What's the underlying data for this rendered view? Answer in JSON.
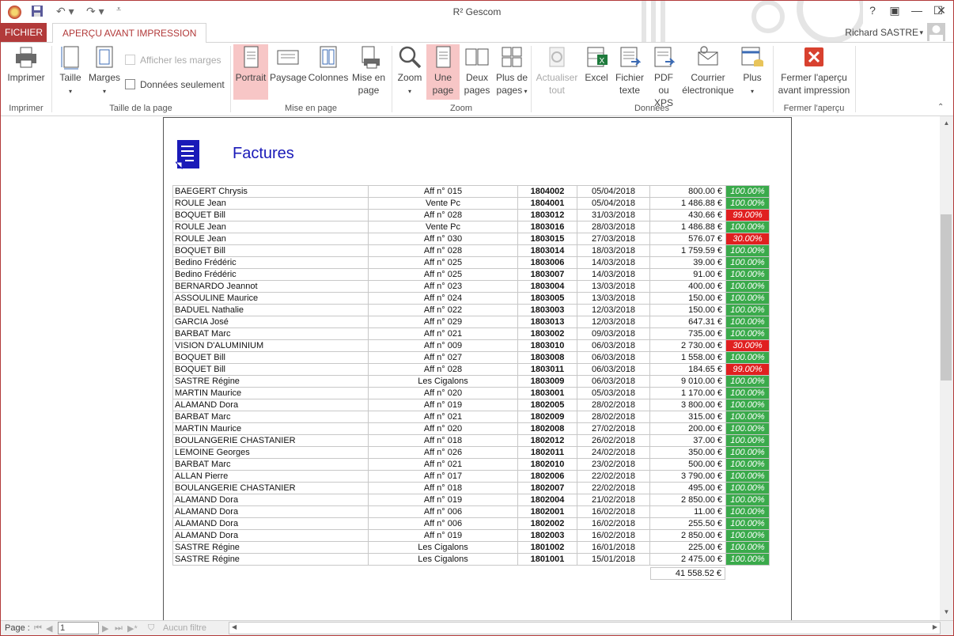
{
  "window": {
    "title": "R² Gescom",
    "help_label": "?",
    "user": "Richard SASTRE"
  },
  "tabs": {
    "file": "FICHIER",
    "active": "APERÇU AVANT IMPRESSION"
  },
  "ribbon": {
    "print": "Imprimer",
    "print_group": "Imprimer",
    "size": "Taille",
    "margins": "Marges",
    "show_margins": "Afficher les marges",
    "data_only": "Données seulement",
    "page_size_group": "Taille de la page",
    "portrait": "Portrait",
    "landscape": "Paysage",
    "columns": "Colonnes",
    "page_setup_1": "Mise en",
    "page_setup_2": "page",
    "layout_group": "Mise en page",
    "zoom": "Zoom",
    "one_page_1": "Une",
    "one_page_2": "page",
    "two_pages_1": "Deux",
    "two_pages_2": "pages",
    "more_pages_1": "Plus de",
    "more_pages_2": "pages",
    "zoom_group": "Zoom",
    "refresh_1": "Actualiser",
    "refresh_2": "tout",
    "excel": "Excel",
    "text_file_1": "Fichier",
    "text_file_2": "texte",
    "pdf_1": "PDF",
    "pdf_2": "ou XPS",
    "email_1": "Courrier",
    "email_2": "électronique",
    "more": "Plus",
    "data_group": "Données",
    "close_1": "Fermer l'aperçu",
    "close_2": "avant impression",
    "close_group": "Fermer l'aperçu"
  },
  "report": {
    "title": "Factures",
    "rows": [
      {
        "name": "BAEGERT Chrysis",
        "aff": "Aff n° 015",
        "num": "1804002",
        "date": "05/04/2018",
        "amount": "800.00 €",
        "pct": "100.00%",
        "status": "green"
      },
      {
        "name": "ROULE Jean",
        "aff": "Vente Pc",
        "num": "1804001",
        "date": "05/04/2018",
        "amount": "1 486.88 €",
        "pct": "100.00%",
        "status": "green"
      },
      {
        "name": "BOQUET Bill",
        "aff": "Aff n° 028",
        "num": "1803012",
        "date": "31/03/2018",
        "amount": "430.66 €",
        "pct": "99.00%",
        "status": "red"
      },
      {
        "name": "ROULE Jean",
        "aff": "Vente Pc",
        "num": "1803016",
        "date": "28/03/2018",
        "amount": "1 486.88 €",
        "pct": "100.00%",
        "status": "green"
      },
      {
        "name": "ROULE Jean",
        "aff": "Aff n° 030",
        "num": "1803015",
        "date": "27/03/2018",
        "amount": "576.07 €",
        "pct": "30.00%",
        "status": "red"
      },
      {
        "name": "BOQUET Bill",
        "aff": "Aff n° 028",
        "num": "1803014",
        "date": "18/03/2018",
        "amount": "1 759.59 €",
        "pct": "100.00%",
        "status": "green"
      },
      {
        "name": "Bedino Frédéric",
        "aff": "Aff n° 025",
        "num": "1803006",
        "date": "14/03/2018",
        "amount": "39.00 €",
        "pct": "100.00%",
        "status": "green"
      },
      {
        "name": "Bedino Frédéric",
        "aff": "Aff n° 025",
        "num": "1803007",
        "date": "14/03/2018",
        "amount": "91.00 €",
        "pct": "100.00%",
        "status": "green"
      },
      {
        "name": "BERNARDO Jeannot",
        "aff": "Aff n° 023",
        "num": "1803004",
        "date": "13/03/2018",
        "amount": "400.00 €",
        "pct": "100.00%",
        "status": "green"
      },
      {
        "name": "ASSOULINE Maurice",
        "aff": "Aff n° 024",
        "num": "1803005",
        "date": "13/03/2018",
        "amount": "150.00 €",
        "pct": "100.00%",
        "status": "green"
      },
      {
        "name": "BADUEL Nathalie",
        "aff": "Aff n° 022",
        "num": "1803003",
        "date": "12/03/2018",
        "amount": "150.00 €",
        "pct": "100.00%",
        "status": "green"
      },
      {
        "name": "GARCIA José",
        "aff": "Aff n° 029",
        "num": "1803013",
        "date": "12/03/2018",
        "amount": "647.31 €",
        "pct": "100.00%",
        "status": "green"
      },
      {
        "name": "BARBAT Marc",
        "aff": "Aff n° 021",
        "num": "1803002",
        "date": "09/03/2018",
        "amount": "735.00 €",
        "pct": "100.00%",
        "status": "green"
      },
      {
        "name": "VISION D'ALUMINIUM",
        "aff": "Aff n° 009",
        "num": "1803010",
        "date": "06/03/2018",
        "amount": "2 730.00 €",
        "pct": "30.00%",
        "status": "red"
      },
      {
        "name": "BOQUET Bill",
        "aff": "Aff n° 027",
        "num": "1803008",
        "date": "06/03/2018",
        "amount": "1 558.00 €",
        "pct": "100.00%",
        "status": "green"
      },
      {
        "name": "BOQUET Bill",
        "aff": "Aff n° 028",
        "num": "1803011",
        "date": "06/03/2018",
        "amount": "184.65 €",
        "pct": "99.00%",
        "status": "red"
      },
      {
        "name": "SASTRE Régine",
        "aff": "Les Cigalons",
        "num": "1803009",
        "date": "06/03/2018",
        "amount": "9 010.00 €",
        "pct": "100.00%",
        "status": "green"
      },
      {
        "name": "MARTIN Maurice",
        "aff": "Aff n° 020",
        "num": "1803001",
        "date": "05/03/2018",
        "amount": "1 170.00 €",
        "pct": "100.00%",
        "status": "green"
      },
      {
        "name": "ALAMAND Dora",
        "aff": "Aff n° 019",
        "num": "1802005",
        "date": "28/02/2018",
        "amount": "3 800.00 €",
        "pct": "100.00%",
        "status": "green"
      },
      {
        "name": "BARBAT Marc",
        "aff": "Aff n° 021",
        "num": "1802009",
        "date": "28/02/2018",
        "amount": "315.00 €",
        "pct": "100.00%",
        "status": "green"
      },
      {
        "name": "MARTIN Maurice",
        "aff": "Aff n° 020",
        "num": "1802008",
        "date": "27/02/2018",
        "amount": "200.00 €",
        "pct": "100.00%",
        "status": "green"
      },
      {
        "name": "BOULANGERIE CHASTANIER",
        "aff": "Aff n° 018",
        "num": "1802012",
        "date": "26/02/2018",
        "amount": "37.00 €",
        "pct": "100.00%",
        "status": "green"
      },
      {
        "name": "LEMOINE Georges",
        "aff": "Aff n° 026",
        "num": "1802011",
        "date": "24/02/2018",
        "amount": "350.00 €",
        "pct": "100.00%",
        "status": "green"
      },
      {
        "name": "BARBAT Marc",
        "aff": "Aff n° 021",
        "num": "1802010",
        "date": "23/02/2018",
        "amount": "500.00 €",
        "pct": "100.00%",
        "status": "green"
      },
      {
        "name": "ALLAN Pierre",
        "aff": "Aff n° 017",
        "num": "1802006",
        "date": "22/02/2018",
        "amount": "3 790.00 €",
        "pct": "100.00%",
        "status": "green"
      },
      {
        "name": "BOULANGERIE CHASTANIER",
        "aff": "Aff n° 018",
        "num": "1802007",
        "date": "22/02/2018",
        "amount": "495.00 €",
        "pct": "100.00%",
        "status": "green"
      },
      {
        "name": "ALAMAND Dora",
        "aff": "Aff n° 019",
        "num": "1802004",
        "date": "21/02/2018",
        "amount": "2 850.00 €",
        "pct": "100.00%",
        "status": "green"
      },
      {
        "name": "ALAMAND Dora",
        "aff": "Aff n° 006",
        "num": "1802001",
        "date": "16/02/2018",
        "amount": "11.00 €",
        "pct": "100.00%",
        "status": "green"
      },
      {
        "name": "ALAMAND Dora",
        "aff": "Aff n° 006",
        "num": "1802002",
        "date": "16/02/2018",
        "amount": "255.50 €",
        "pct": "100.00%",
        "status": "green"
      },
      {
        "name": "ALAMAND Dora",
        "aff": "Aff n° 019",
        "num": "1802003",
        "date": "16/02/2018",
        "amount": "2 850.00 €",
        "pct": "100.00%",
        "status": "green"
      },
      {
        "name": "SASTRE Régine",
        "aff": "Les Cigalons",
        "num": "1801002",
        "date": "16/01/2018",
        "amount": "225.00 €",
        "pct": "100.00%",
        "status": "green"
      },
      {
        "name": "SASTRE Régine",
        "aff": "Les Cigalons",
        "num": "1801001",
        "date": "15/01/2018",
        "amount": "2 475.00 €",
        "pct": "100.00%",
        "status": "green"
      }
    ],
    "total": "41 558.52 €"
  },
  "status": {
    "page_label": "Page :",
    "page_value": "1",
    "filter": "Aucun filtre"
  },
  "colors": {
    "accent": "#b23a3a",
    "title_blue": "#1a1ab8",
    "ok": "#3aaa4b",
    "warn": "#e02020"
  }
}
